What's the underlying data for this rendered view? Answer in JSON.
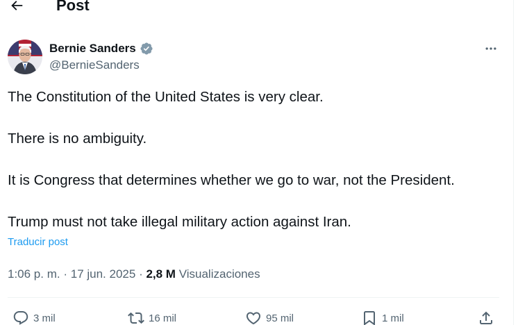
{
  "header": {
    "title": "Post"
  },
  "author": {
    "name": "Bernie Sanders",
    "handle": "@BernieSanders"
  },
  "tweet": {
    "lines": [
      "The Constitution of the United States is very clear.",
      "There is no ambiguity.",
      "It is Congress that determines whether we go to war, not the President.",
      "Trump must not take illegal military action against Iran."
    ],
    "translate_label": "Traducir post"
  },
  "meta": {
    "time": "1:06 p. m.",
    "date": "17 jun. 2025",
    "views_count": "2,8 M",
    "views_label": "Visualizaciones"
  },
  "actions": {
    "replies": "3 mil",
    "reposts": "16 mil",
    "likes": "95 mil",
    "bookmarks": "1 mil"
  },
  "colors": {
    "accent": "#1d9bf0",
    "secondary_text": "#536471",
    "primary_text": "#0f1419"
  }
}
